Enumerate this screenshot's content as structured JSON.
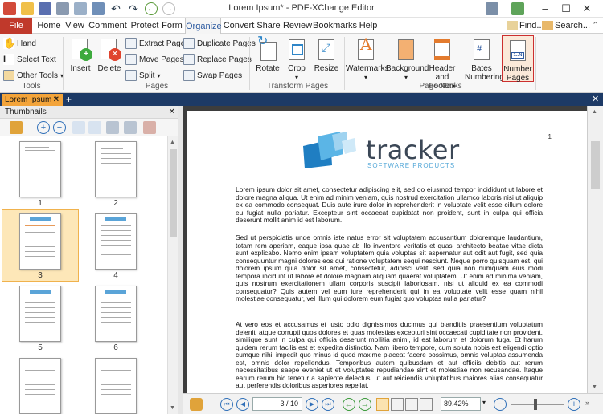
{
  "window": {
    "title": "Lorem Ipsum* - PDF-XChange Editor"
  },
  "menu": {
    "file": "File",
    "tabs": [
      "Home",
      "View",
      "Comment",
      "Protect",
      "Form",
      "Organize",
      "Convert",
      "Share",
      "Review",
      "Bookmarks",
      "Help"
    ],
    "active_tab": "Organize",
    "find": "Find...",
    "search": "Search..."
  },
  "ribbon": {
    "tools": {
      "label": "Tools",
      "hand": "Hand",
      "select_text": "Select Text",
      "other_tools": "Other Tools"
    },
    "pages": {
      "label": "Pages",
      "insert": "Insert",
      "delete": "Delete",
      "extract": "Extract Pages",
      "move": "Move Pages",
      "split": "Split",
      "duplicate": "Duplicate Pages",
      "replace": "Replace Pages",
      "swap": "Swap Pages"
    },
    "transform": {
      "label": "Transform Pages",
      "rotate": "Rotate",
      "crop": "Crop",
      "resize": "Resize"
    },
    "marks": {
      "label": "Page Marks",
      "watermarks": "Watermarks",
      "background": "Background",
      "header_footer_1": "Header and",
      "header_footer_2": "Footer",
      "bates_1": "Bates",
      "bates_2": "Numbering",
      "number_1": "Number",
      "number_2": "Pages"
    }
  },
  "doc_tab": {
    "label": "Lorem Ipsum *"
  },
  "thumbnails": {
    "title": "Thumbnails",
    "pages": [
      "1",
      "2",
      "3",
      "4",
      "5",
      "6"
    ],
    "selected": "3"
  },
  "document": {
    "page_number": "1",
    "logo": "tracker",
    "logo_sub": "SOFTWARE PRODUCTS",
    "paragraphs": [
      "Lorem ipsum dolor sit amet, consectetur adipiscing elit, sed do eiusmod tempor incididunt ut labore et dolore magna aliqua. Ut enim ad minim veniam, quis nostrud exercitation ullamco laboris nisi ut aliquip ex ea commodo consequat. Duis aute irure dolor in reprehenderit in voluptate velit esse cillum dolore eu fugiat nulla pariatur. Excepteur sint occaecat cupidatat non proident, sunt in culpa qui officia deserunt mollit anim id est laborum.",
      "Sed ut perspiciatis unde omnis iste natus error sit voluptatem accusantium doloremque laudantium, totam rem aperiam, eaque ipsa quae ab illo inventore veritatis et quasi architecto beatae vitae dicta sunt explicabo. Nemo enim ipsam voluptatem quia voluptas sit aspernatur aut odit aut fugit, sed quia consequuntur magni dolores eos qui ratione voluptatem sequi nesciunt. Neque porro quisquam est, qui dolorem ipsum quia dolor sit amet, consectetur, adipisci velit, sed quia non numquam eius modi tempora incidunt ut labore et dolore magnam aliquam quaerat voluptatem. Ut enim ad minima veniam, quis nostrum exercitationem ullam corporis suscipit laboriosam, nisi ut aliquid ex ea commodi consequatur? Quis autem vel eum iure reprehenderit qui in ea voluptate velit esse quam nihil molestiae consequatur, vel illum qui dolorem eum fugiat quo voluptas nulla pariatur?",
      "At vero eos et accusamus et iusto odio dignissimos ducimus qui blanditiis praesentium voluptatum deleniti atque corrupti quos dolores et quas molestias excepturi sint occaecati cupiditate non provident, similique sunt in culpa qui officia deserunt mollitia animi, id est laborum et dolorum fuga. Et harum quidem rerum facilis est et expedita distinctio. Nam libero tempore, cum soluta nobis est eligendi optio cumque nihil impedit quo minus id quod maxime placeat facere possimus, omnis voluptas assumenda est, omnis dolor repellendus. Temporibus autem quibusdam et aut officiis debitis aut rerum necessitatibus saepe eveniet ut et voluptates repudiandae sint et molestiae non recusandae. Itaque earum rerum hic tenetur a sapiente delectus, ut aut reiciendis voluptatibus maiores alias consequatur aut perferendis doloribus asperiores repellat."
    ]
  },
  "status": {
    "page": "3 / 10",
    "zoom": "89.42%"
  },
  "colors": {
    "file_tab": "#c0392b",
    "doc_tab_bar": "#1d3a66",
    "doc_tab": "#f3a43a",
    "highlight": "#cc2f2f"
  }
}
